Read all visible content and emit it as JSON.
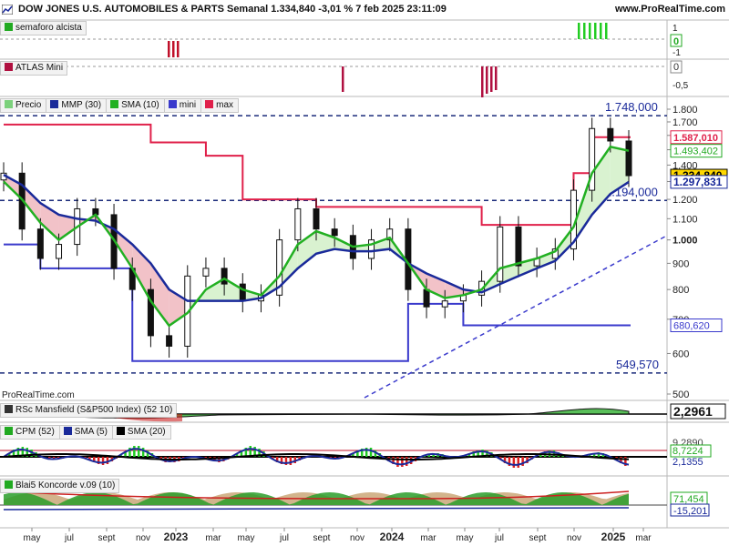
{
  "header": {
    "title": "DOW JONES U.S. AUTOMOBILES & PARTS Semanal 1.334,840 -3,01 % 7 feb 2025 23:11:09",
    "brand": "www.ProRealTime.com"
  },
  "watermark": "ProRealTime.com",
  "panels": {
    "semaforo": {
      "label": "semaforo alcista",
      "scale": [
        "1",
        "-1"
      ],
      "value": "0"
    },
    "atlas": {
      "label": "ATLAS Mini",
      "scale": [
        "-0,5"
      ],
      "value": "0"
    },
    "price": {
      "legend": [
        {
          "label": "Precio",
          "color": "#7cd17c"
        },
        {
          "label": "MMP (30)",
          "color": "#1a2a9a"
        },
        {
          "label": "SMA (10)",
          "color": "#22b022"
        },
        {
          "label": "mini",
          "color": "#3a3acc"
        },
        {
          "label": "max",
          "color": "#e0204a"
        }
      ],
      "level_labels": {
        "top": "1.748,000",
        "mid": "1.194,000",
        "low": "549,570"
      },
      "value_tags": [
        {
          "text": "1.587,010",
          "color": "#e0204a",
          "bg": "#ffffff",
          "v": 1587
        },
        {
          "text": "1.493,402",
          "color": "#22aa22",
          "bg": "#ffffff",
          "v": 1493
        },
        {
          "text": "1.334,840",
          "color": "#000000",
          "bg": "#ffd800",
          "v": 1335
        },
        {
          "text": "1.297,831",
          "color": "#1a2a9a",
          "bg": "#ffffff",
          "v": 1298
        },
        {
          "text": "680,620",
          "color": "#3a3acc",
          "bg": "#ffffff",
          "v": 681
        }
      ],
      "ticks": [
        "1.800",
        "1.700",
        "1.600",
        "1.500",
        "1.400",
        "1.300",
        "1.200",
        "1.100",
        "1.000",
        "900",
        "800",
        "700",
        "600",
        "500"
      ]
    },
    "rsc": {
      "label": "RSc Mansfield (S&P500 Index) (52 10)",
      "value": "2,2961"
    },
    "cpm": {
      "legend": [
        {
          "label": "CPM (52)",
          "color": "#22aa22"
        },
        {
          "label": "SMA (5)",
          "color": "#1a2a9a"
        },
        {
          "label": "SMA (20)",
          "color": "#000000"
        }
      ],
      "values": [
        "9,2890",
        "8,7224",
        "2,1355"
      ]
    },
    "koncorde": {
      "label": "Blai5 Koncorde v.09 (10)",
      "values": [
        "71,454",
        "-15,201"
      ]
    }
  },
  "x_axis": [
    "may",
    "jul",
    "sept",
    "nov",
    "2023",
    "mar",
    "may",
    "jul",
    "sept",
    "nov",
    "2024",
    "mar",
    "may",
    "jul",
    "sept",
    "nov",
    "2025",
    "mar"
  ],
  "chart_data": {
    "type": "candlestick",
    "title": "DOW JONES U.S. AUTOMOBILES & PARTS Semanal",
    "period": "weekly",
    "last_close": 1334.84,
    "change_pct": -3.01,
    "date": "7 feb 2025",
    "y_range": [
      500,
      1800
    ],
    "horizontal_levels": [
      1748,
      1194,
      549.57
    ],
    "trendline": {
      "from": [
        "2023-09",
        560
      ],
      "to": [
        "2025-03",
        1020
      ]
    },
    "series": [
      {
        "name": "Precio",
        "type": "close",
        "x": [
          "2022-04",
          "2022-05",
          "2022-06",
          "2022-07",
          "2022-08",
          "2022-09",
          "2022-10",
          "2022-11",
          "2022-12",
          "2023-01",
          "2023-02",
          "2023-03",
          "2023-04",
          "2023-05",
          "2023-06",
          "2023-07",
          "2023-08",
          "2023-09",
          "2023-10",
          "2023-11",
          "2023-12",
          "2024-01",
          "2024-02",
          "2024-03",
          "2024-04",
          "2024-05",
          "2024-06",
          "2024-07",
          "2024-08",
          "2024-09",
          "2024-10",
          "2024-11",
          "2024-12",
          "2025-01",
          "2025-02"
        ],
        "values": [
          1350,
          1050,
          920,
          980,
          1150,
          1120,
          880,
          800,
          650,
          620,
          850,
          880,
          820,
          760,
          780,
          1000,
          1150,
          1050,
          1020,
          920,
          1000,
          1050,
          800,
          740,
          760,
          780,
          830,
          1060,
          890,
          920,
          960,
          1250,
          1650,
          1560,
          1335
        ]
      },
      {
        "name": "MMP (30)",
        "values": [
          1340,
          1280,
          1180,
          1120,
          1100,
          1090,
          1050,
          980,
          900,
          800,
          760,
          760,
          760,
          760,
          770,
          810,
          880,
          940,
          960,
          950,
          950,
          960,
          900,
          860,
          830,
          800,
          790,
          820,
          850,
          880,
          910,
          990,
          1120,
          1230,
          1298
        ]
      },
      {
        "name": "SMA (10)",
        "values": [
          1300,
          1200,
          1080,
          1000,
          1060,
          1120,
          1000,
          880,
          760,
          680,
          720,
          800,
          840,
          800,
          780,
          850,
          980,
          1040,
          1010,
          970,
          980,
          1010,
          900,
          800,
          770,
          780,
          800,
          880,
          900,
          920,
          950,
          1060,
          1350,
          1520,
          1493
        ]
      },
      {
        "name": "mini",
        "values": [
          980,
          980,
          880,
          880,
          880,
          880,
          880,
          580,
          580,
          580,
          580,
          580,
          580,
          580,
          580,
          580,
          580,
          580,
          580,
          580,
          580,
          580,
          750,
          750,
          750,
          681,
          681,
          681,
          681,
          681,
          681,
          681,
          681,
          681,
          681
        ]
      },
      {
        "name": "max",
        "values": [
          1680,
          1680,
          1680,
          1680,
          1680,
          1680,
          1680,
          1680,
          1550,
          1550,
          1550,
          1460,
          1460,
          1200,
          1200,
          1200,
          1200,
          1160,
          1160,
          1160,
          1160,
          1160,
          1160,
          1160,
          1160,
          1160,
          1070,
          1070,
          1070,
          1070,
          1070,
          1350,
          1587,
          1587,
          1587
        ]
      }
    ]
  }
}
